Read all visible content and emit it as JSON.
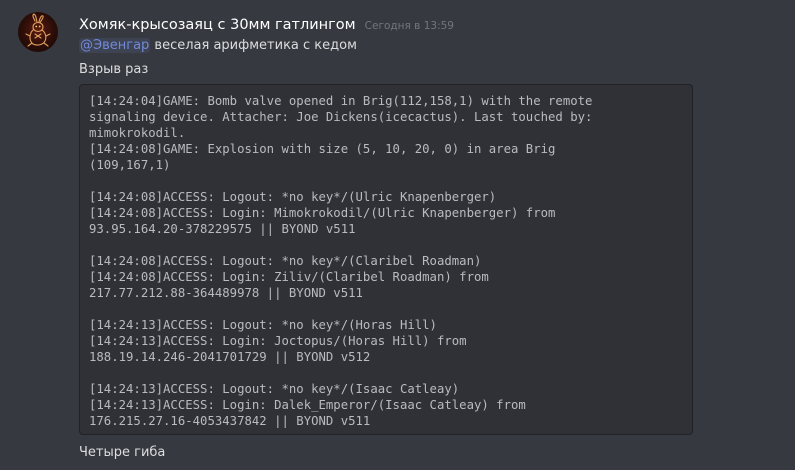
{
  "author": {
    "username": "Хомяк-крысозаяц с 30мм гатлингом",
    "avatar_icon": "rabbit-icon"
  },
  "timestamp": "Сегодня в 13:59",
  "message": {
    "mention": "@Эвенгар",
    "line1_text": " веселая арифметика с кедом",
    "line2_text": "Взрыв раз",
    "code": "[14:24:04]GAME: Bomb valve opened in Brig(112,158,1) with the remote\nsignaling device. Attacher: Joe Dickens(icecactus). Last touched by:\nmimokrokodil.\n[14:24:08]GAME: Explosion with size (5, 10, 20, 0) in area Brig\n(109,167,1)\n\n[14:24:08]ACCESS: Logout: *no key*/(Ulric Knapenberger)\n[14:24:08]ACCESS: Login: Mimokrokodil/(Ulric Knapenberger) from\n93.95.164.20-378229575 || BYOND v511\n\n[14:24:08]ACCESS: Logout: *no key*/(Claribel Roadman)\n[14:24:08]ACCESS: Login: Ziliv/(Claribel Roadman) from\n217.77.212.88-364489978 || BYOND v511\n\n[14:24:13]ACCESS: Logout: *no key*/(Horas Hill)\n[14:24:13]ACCESS: Login: Joctopus/(Horas Hill) from\n188.19.14.246-2041701729 || BYOND v512\n\n[14:24:13]ACCESS: Logout: *no key*/(Isaac Catleay)\n[14:24:13]ACCESS: Login: Dalek_Emperor/(Isaac Catleay) from\n176.215.27.16-4053437842 || BYOND v511",
    "line3_text": "Четыре гиба"
  },
  "colors": {
    "background": "#36393f",
    "code_background": "#2f3136",
    "mention": "#7289da",
    "username": "#ffffff",
    "timestamp": "#72767d"
  }
}
